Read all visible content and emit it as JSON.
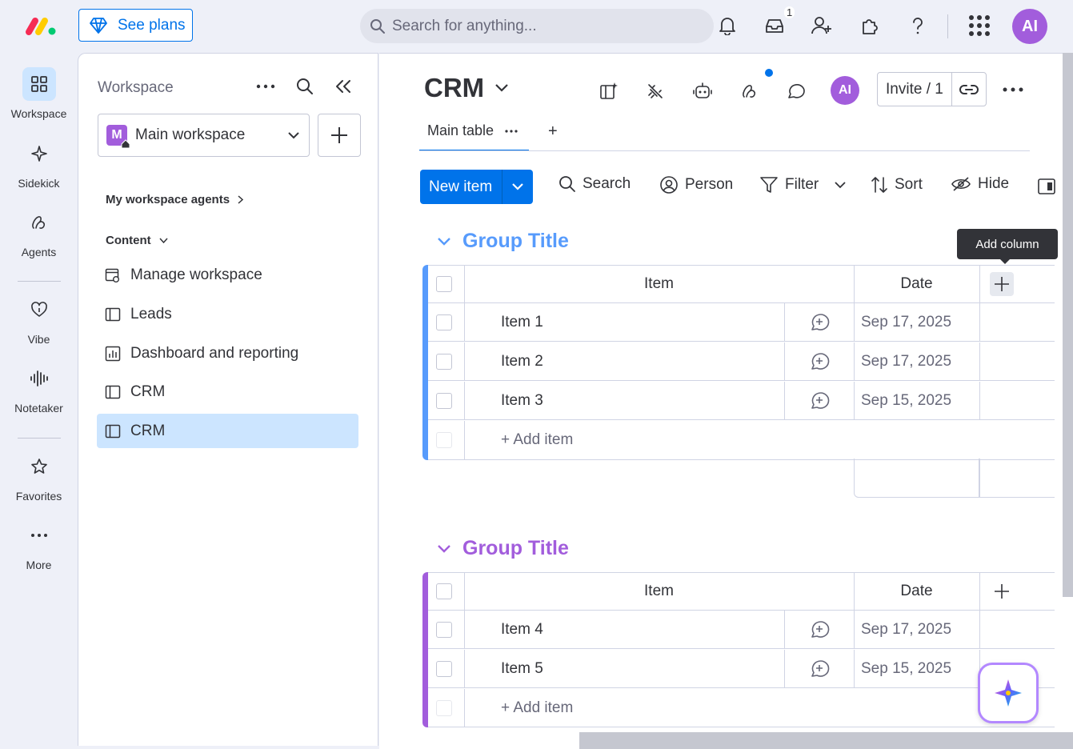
{
  "topbar": {
    "see_plans": "See plans",
    "search_placeholder": "Search for anything...",
    "inbox_count": "1",
    "user_initials": "AI"
  },
  "rail": {
    "items": [
      {
        "label": "Workspace",
        "icon": "grid-icon",
        "active": true
      },
      {
        "label": "Sidekick",
        "icon": "sparkle-icon"
      },
      {
        "label": "Agents",
        "icon": "agents-icon"
      },
      {
        "label": "Vibe",
        "icon": "heart-icon"
      },
      {
        "label": "Notetaker",
        "icon": "waveform-icon"
      },
      {
        "label": "Favorites",
        "icon": "star-icon"
      },
      {
        "label": "More",
        "icon": "more-icon"
      }
    ]
  },
  "workspace": {
    "title": "Workspace",
    "selected": "Main workspace",
    "avatar_letter": "M",
    "agents_section": "My workspace agents",
    "content_section": "Content",
    "items": [
      {
        "label": "Manage workspace",
        "icon": "manage-icon"
      },
      {
        "label": "Leads",
        "icon": "board-icon"
      },
      {
        "label": "Dashboard and reporting",
        "icon": "dashboard-icon"
      },
      {
        "label": "CRM",
        "icon": "board-icon"
      },
      {
        "label": "CRM",
        "icon": "board-icon",
        "selected": true
      }
    ]
  },
  "board": {
    "title": "CRM",
    "avatar_initials": "AI",
    "invite_label": "Invite / 1",
    "tab_main": "Main table",
    "tab_add": "+",
    "new_item": "New item",
    "tools": {
      "search": "Search",
      "person": "Person",
      "filter": "Filter",
      "sort": "Sort",
      "hide": "Hide"
    },
    "tooltip": "Add column",
    "groups": [
      {
        "title": "Group Title",
        "color": "#579bfc",
        "col_item": "Item",
        "col_date": "Date",
        "rows": [
          {
            "name": "Item 1",
            "date": "Sep 17, 2025"
          },
          {
            "name": "Item 2",
            "date": "Sep 17, 2025"
          },
          {
            "name": "Item 3",
            "date": "Sep 15, 2025"
          }
        ],
        "add_item": "+ Add item"
      },
      {
        "title": "Group Title",
        "color": "#a25ddc",
        "col_item": "Item",
        "col_date": "Date",
        "rows": [
          {
            "name": "Item 4",
            "date": "Sep 17, 2025"
          },
          {
            "name": "Item 5",
            "date": "Sep 15, 2025"
          }
        ],
        "add_item": "+ Add item"
      }
    ]
  },
  "colors": {
    "primary": "#0073ea",
    "selected_bg": "#cce5ff",
    "purple": "#a25ddc",
    "blue_group": "#579bfc"
  }
}
